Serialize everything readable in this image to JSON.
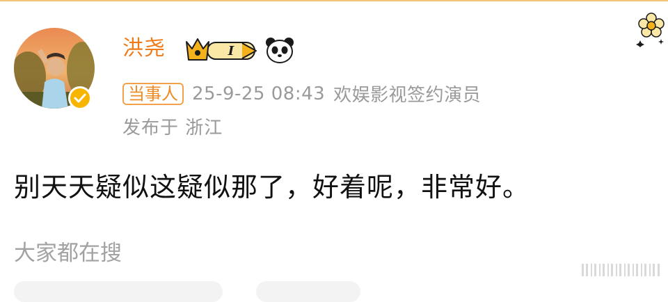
{
  "post": {
    "author": "洪尧",
    "role_tag": "当事人",
    "timestamp": "25-9-25 08:43",
    "source": "欢娱影视签约演员",
    "location": "发布于 浙江",
    "content": "别天天疑似这疑似那了，好着呢，非常好。",
    "badge_level": "I"
  },
  "section": {
    "search_label": "大家都在搜"
  },
  "colors": {
    "name": "#ef7a1a",
    "tag": "#f08a24",
    "meta": "#9a9a9a",
    "badge_gold": "#f3b21b",
    "verified": "#f7b500"
  },
  "icons": [
    "crown-badge-icon",
    "panda-icon",
    "verified-icon",
    "flower-decoration-icon"
  ]
}
